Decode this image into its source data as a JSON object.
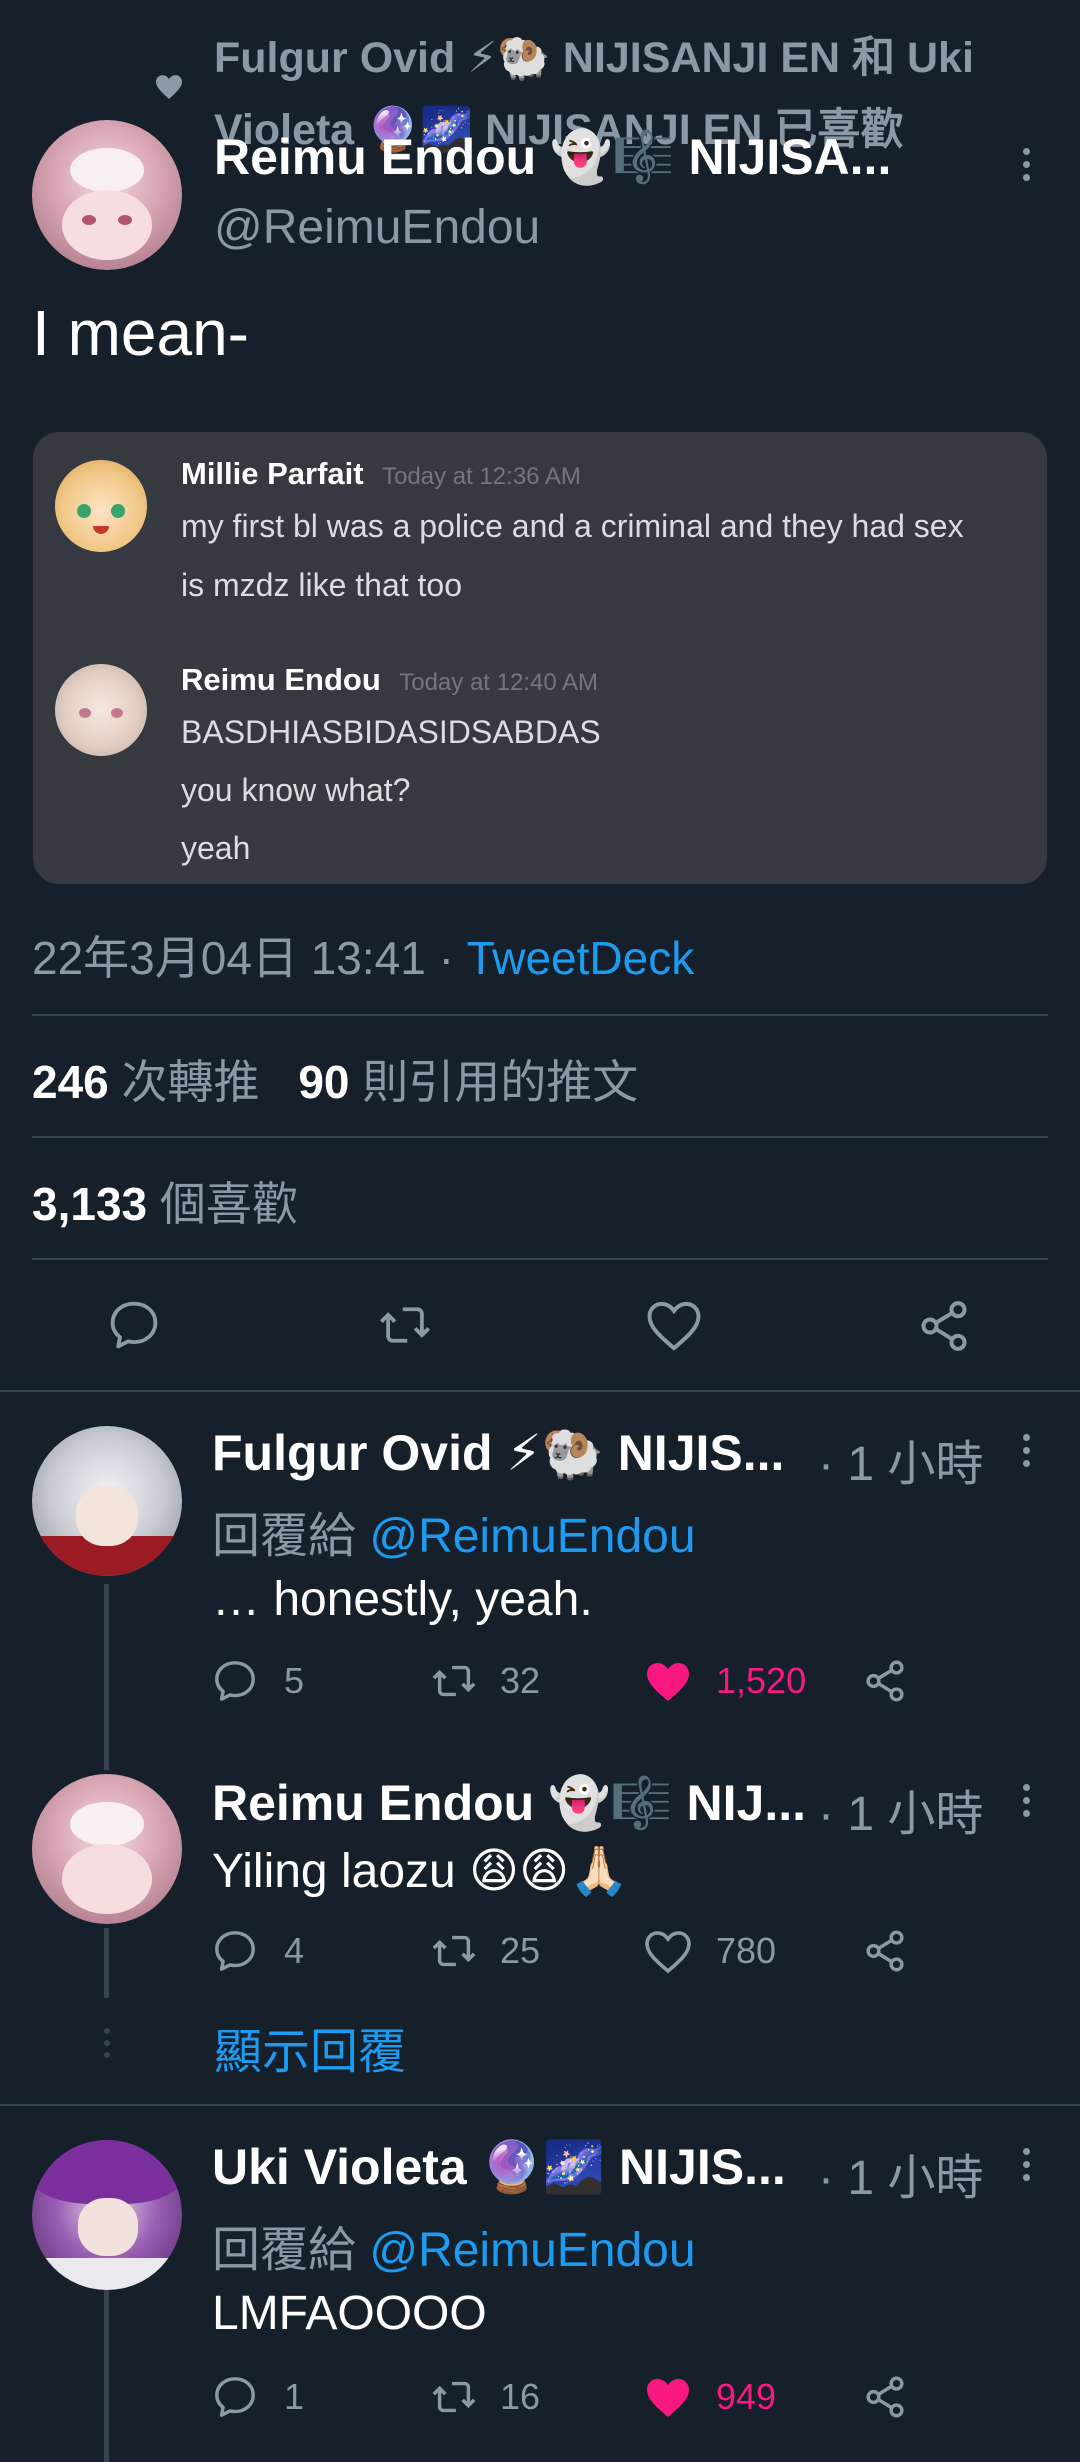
{
  "social_context": {
    "line1": "Fulgur Ovid ⚡🐏 NIJISANJI EN 和 Uki",
    "line2": "Violeta 🔮🌌 NIJISANJI EN 已喜歡"
  },
  "main_tweet": {
    "author_name": "Reimu Endou 👻🎼 NIJISA...",
    "handle": "@ReimuEndou",
    "text": "I mean-",
    "timestamp": "22年3月04日 13:41 · ",
    "source": "TweetDeck",
    "retweets_count": "246",
    "retweets_label": "次轉推",
    "quotes_count": "90",
    "quotes_label": "則引用的推文",
    "likes_count": "3,133",
    "likes_label": "個喜歡"
  },
  "embedded_image": {
    "messages": [
      {
        "name": "Millie Parfait",
        "time": "Today at 12:36 AM",
        "lines": [
          "my first bl was a police and a criminal and they had sex",
          "is mzdz like that too"
        ]
      },
      {
        "name": "Reimu Endou",
        "time": "Today at 12:40 AM",
        "lines": [
          "BASDHIASBIDASIDSABDAS",
          "you know what?",
          "yeah"
        ]
      }
    ]
  },
  "replies": [
    {
      "author_name": "Fulgur Ovid ⚡🐏 NIJIS...",
      "time": "· 1 小時",
      "reply_to_label": "回覆給 ",
      "reply_to_handle": "@ReimuEndou",
      "text": "… honestly, yeah.",
      "reply_count": "5",
      "retweet_count": "32",
      "like_count": "1,520",
      "liked": true
    },
    {
      "author_name": "Reimu Endou 👻🎼 NIJ...",
      "time": "· 1 小時",
      "text": "Yiling laozu 😩😩🙏🏻",
      "reply_count": "4",
      "retweet_count": "25",
      "like_count": "780",
      "liked": false,
      "show_replies": "顯示回覆"
    },
    {
      "author_name": "Uki Violeta 🔮🌌 NIJIS...",
      "time": "· 1 小時",
      "reply_to_label": "回覆給 ",
      "reply_to_handle": "@ReimuEndou",
      "text": "LMFAOOOO",
      "reply_count": "1",
      "retweet_count": "16",
      "like_count": "949",
      "liked": true
    }
  ],
  "colors": {
    "background": "#15202b",
    "accent": "#1d9bf0",
    "like": "#f91880",
    "secondary_text": "#8b98a5",
    "divider": "#38444d"
  }
}
